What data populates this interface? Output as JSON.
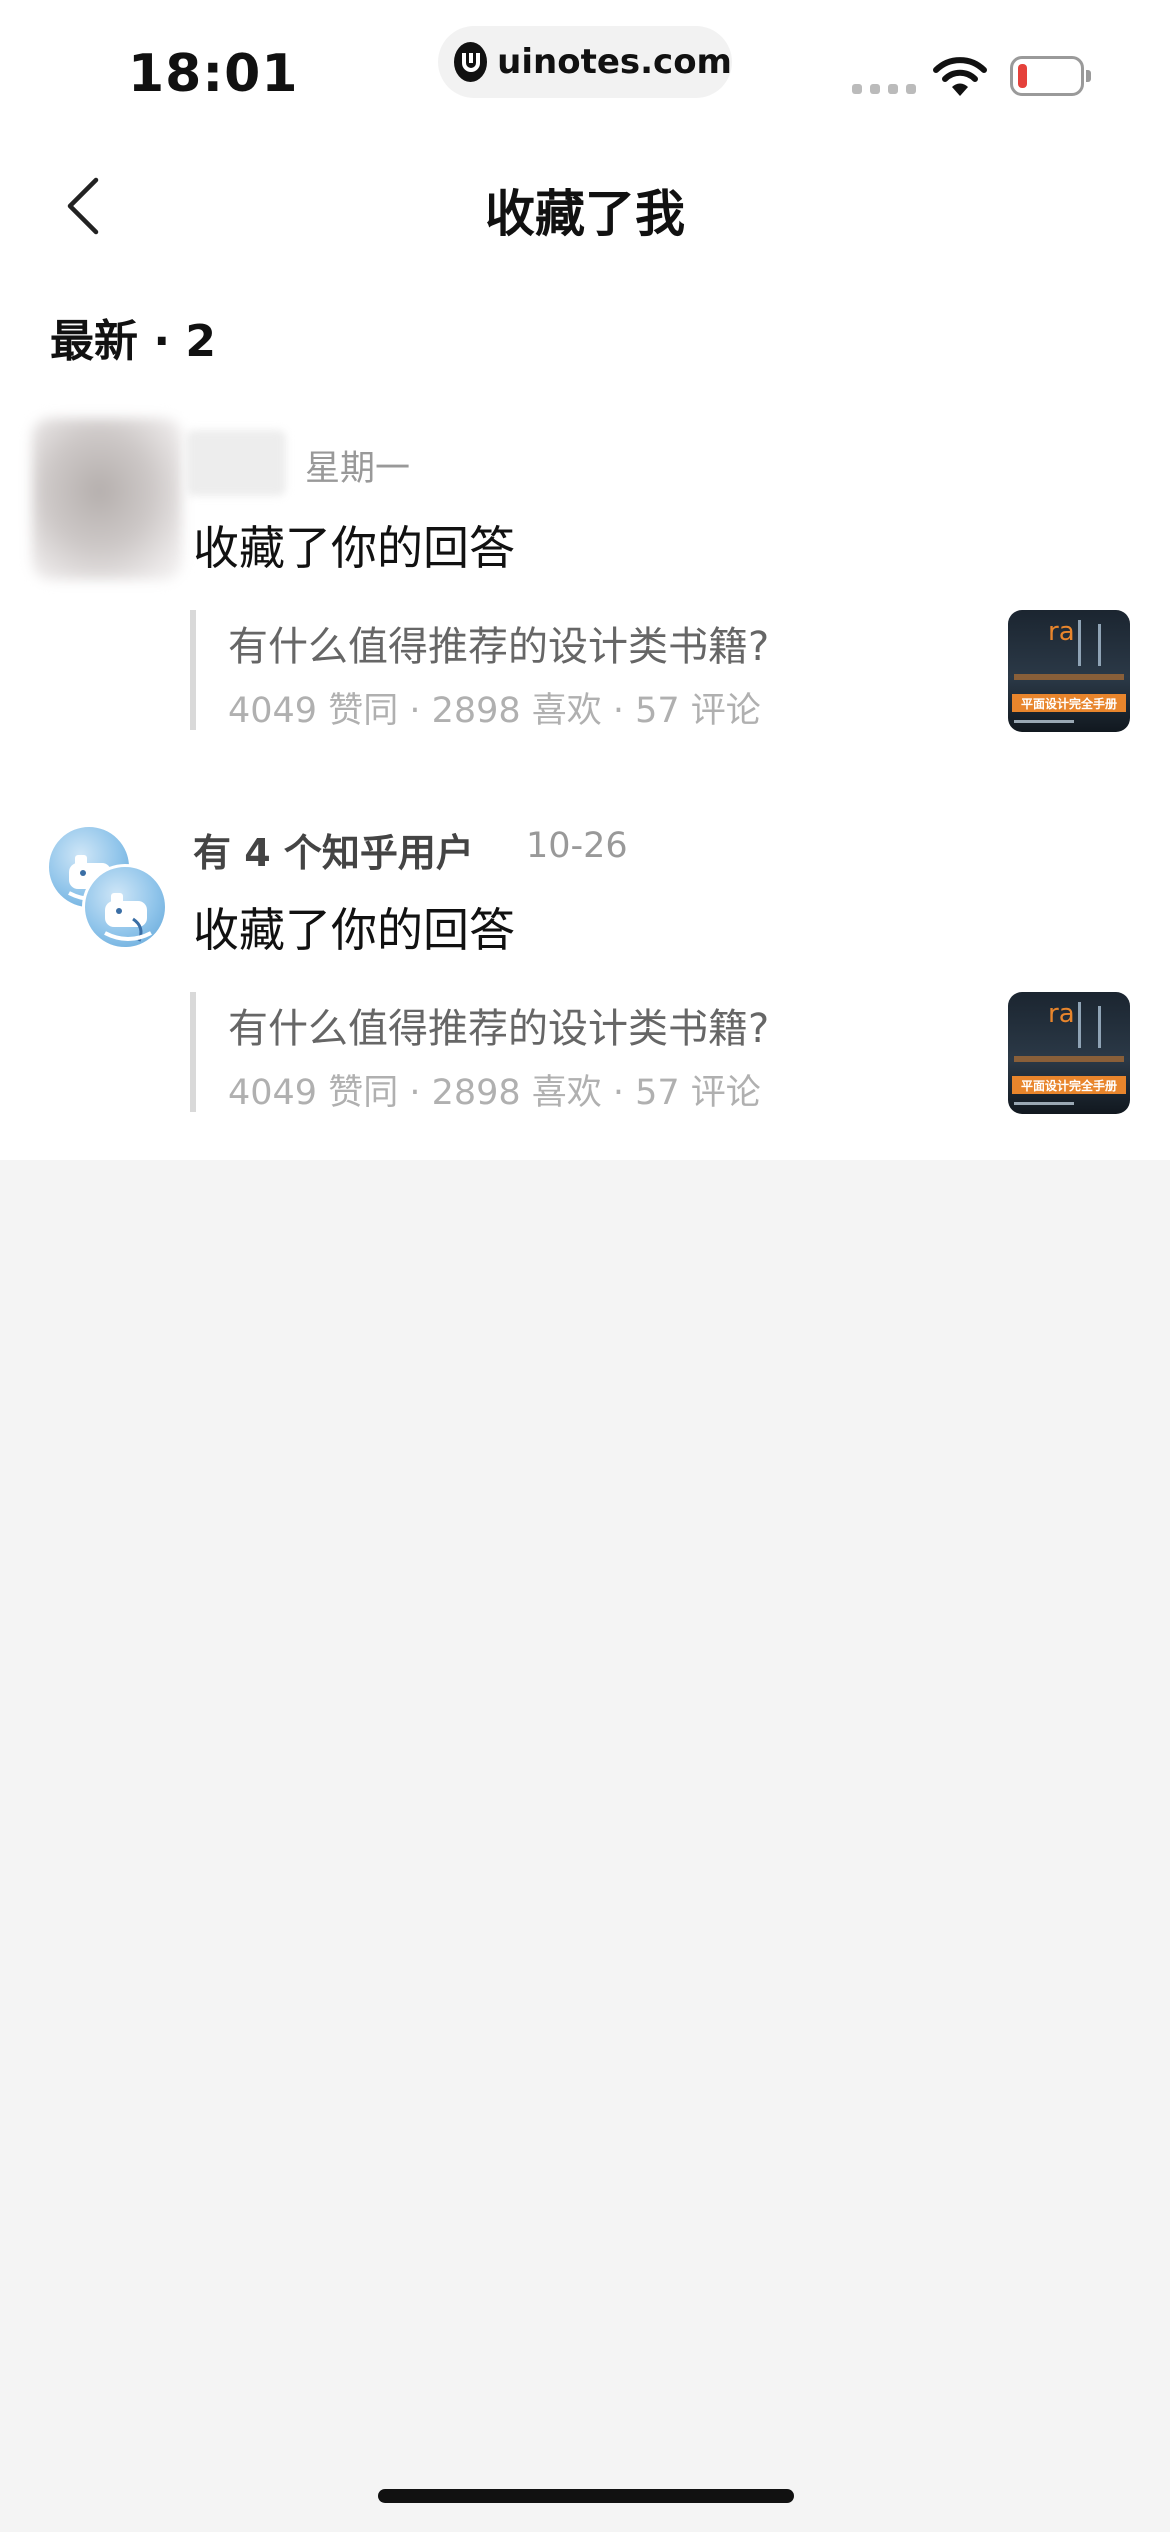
{
  "status_bar": {
    "time": "18:01",
    "url": "uinotes.com",
    "battery_color": "#e5413b"
  },
  "nav": {
    "back_icon": "chevron-left-icon",
    "title": "收藏了我"
  },
  "section": {
    "header": "最新 · 2"
  },
  "notifications": [
    {
      "user": "",
      "date": "星期一",
      "action": "收藏了你的回答",
      "quote": {
        "title": "有什么值得推荐的设计类书籍?",
        "stats": "4049 赞同 · 2898 喜欢 · 57 评论",
        "thumb_caption": "平面设计完全手册"
      }
    },
    {
      "user": "有 4 个知乎用户",
      "date": "10-26",
      "action": "收藏了你的回答",
      "quote": {
        "title": "有什么值得推荐的设计类书籍?",
        "stats": "4049 赞同 · 2898 喜欢 · 57 评论",
        "thumb_caption": "平面设计完全手册"
      }
    }
  ],
  "colors": {
    "accent_orange": "#e8852c",
    "page_background": "#f4f4f4"
  }
}
